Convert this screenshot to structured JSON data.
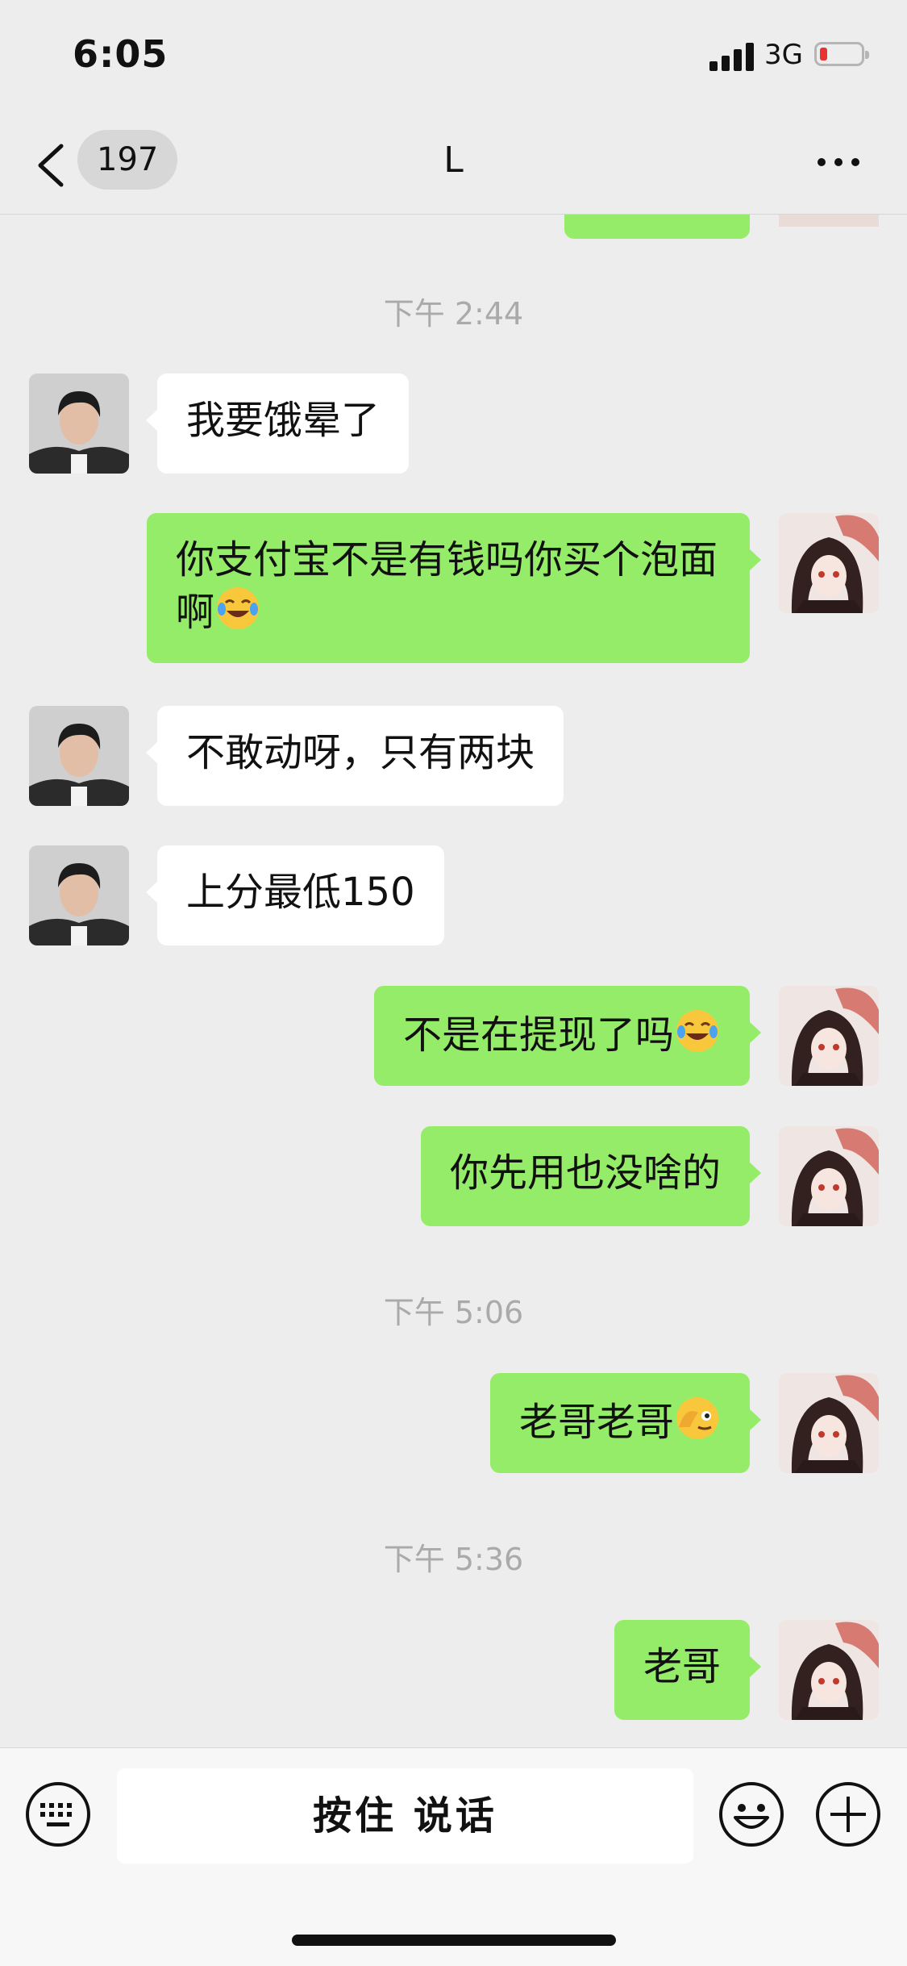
{
  "status_bar": {
    "time": "6:05",
    "network": "3G"
  },
  "nav": {
    "unread_count": "197",
    "title": "L"
  },
  "messages": [
    {
      "type": "timestamp",
      "text": "下午 2:44"
    },
    {
      "type": "received",
      "text": "我要饿晕了"
    },
    {
      "type": "sent",
      "text": "你支付宝不是有钱吗你买个泡面啊",
      "emoji": "tears-of-joy-emoji"
    },
    {
      "type": "received",
      "text": "不敢动呀，只有两块"
    },
    {
      "type": "received",
      "text": "上分最低150"
    },
    {
      "type": "sent",
      "text": "不是在提现了吗",
      "emoji": "tears-of-joy-emoji"
    },
    {
      "type": "sent",
      "text": "你先用也没啥的"
    },
    {
      "type": "timestamp",
      "text": "下午 5:06"
    },
    {
      "type": "sent",
      "text": "老哥老哥",
      "emoji": "peeking-face-emoji"
    },
    {
      "type": "timestamp",
      "text": "下午 5:36"
    },
    {
      "type": "sent",
      "text": "老哥"
    }
  ],
  "input_bar": {
    "voice_button_label": "按住 说话"
  },
  "colors": {
    "background": "#ededed",
    "sent_bubble": "#95ec69",
    "received_bubble": "#ffffff",
    "timestamp": "#aaaaaa",
    "battery_low": "#e8322f"
  },
  "icons": [
    "back-chevron-icon",
    "more-icon",
    "keyboard-icon",
    "emoji-icon",
    "plus-icon"
  ]
}
